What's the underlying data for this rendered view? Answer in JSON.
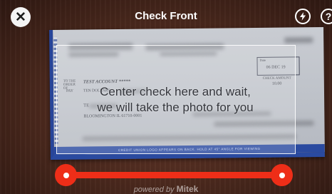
{
  "header": {
    "title": "Check Front",
    "close_icon": "close-icon",
    "flash_icon": "flash-icon",
    "help_label": "?"
  },
  "check": {
    "to_order_label": "TO THE ORDER OF",
    "payee": "TEST ACCOUNT *****",
    "pay_label": "PAY",
    "amount_words": "TEN DOLLARS",
    "date_label": "Date",
    "date_value": "06 DEC 19",
    "amount_label": "CHECK AMOUNT",
    "amount_value": "10.00",
    "address_line": "TE",
    "city_line": "BLOOMINGTON IL 61710-0001",
    "footer_band": "CREDIT UNION LOGO APPEARS ON BACK. HOLD AT 45° ANGLE FOR VIEWING"
  },
  "overlay": {
    "instruction_line1": "Center check here and wait,",
    "instruction_line2": "we will take the photo for you"
  },
  "level_indicator": {
    "color": "#ee2e18",
    "tilt": 0
  },
  "footer": {
    "powered_prefix": "powered by",
    "brand": "Mitek"
  }
}
